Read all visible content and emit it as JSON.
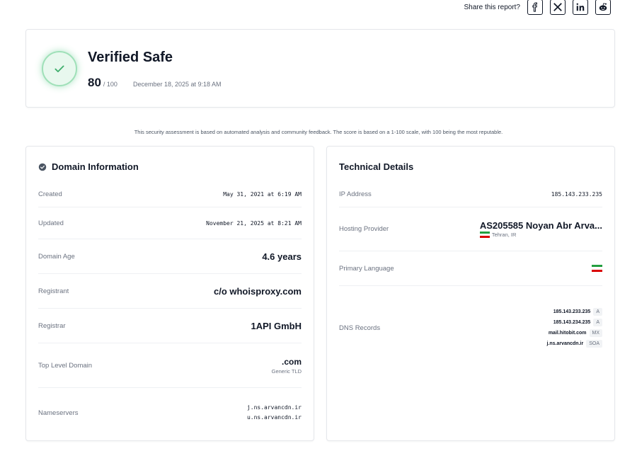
{
  "share": {
    "label": "Share this report?",
    "buttons": [
      {
        "name": "facebook-icon"
      },
      {
        "name": "x-icon"
      },
      {
        "name": "linkedin-icon"
      },
      {
        "name": "reddit-icon"
      }
    ]
  },
  "verdict": {
    "title": "Verified Safe",
    "score": "80",
    "score_max": "/ 100",
    "date": "December 18, 2025 at 9:18 AM",
    "accent": "#4ac47c"
  },
  "disclaimer": "This security assessment is based on automated analysis and community feedback. The score is based on a 1-100 scale, with 100 being the most reputable.",
  "domain_info": {
    "title": "Domain Information",
    "created_label": "Created",
    "created_value": "May 31, 2021 at 6:19 AM",
    "updated_label": "Updated",
    "updated_value": "November 21, 2025 at 8:21 AM",
    "age_label": "Domain Age",
    "age_value": "4.6 years",
    "registrant_label": "Registrant",
    "registrant_value": "c/o whoisproxy.com",
    "registrar_label": "Registrar",
    "registrar_value": "1API GmbH",
    "tld_label": "Top Level Domain",
    "tld_value": ".com",
    "tld_sub": "Generic TLD",
    "ns_label": "Nameservers",
    "ns_values": [
      "j.ns.arvancdn.ir",
      "u.ns.arvancdn.ir"
    ]
  },
  "technical": {
    "title": "Technical Details",
    "ip_label": "IP Address",
    "ip_value": "185.143.233.235",
    "hosting_label": "Hosting Provider",
    "hosting_value": "AS205585 Noyan Abr Arva...",
    "hosting_location": "Tehran, IR",
    "language_label": "Primary Language",
    "dns_label": "DNS Records",
    "dns_records": [
      {
        "value": "185.143.233.235",
        "type": "A"
      },
      {
        "value": "185.143.234.235",
        "type": "A"
      },
      {
        "value": "mail.hitobit.com",
        "type": "MX"
      },
      {
        "value": "j.ns.arvancdn.ir",
        "type": "SOA"
      }
    ]
  }
}
